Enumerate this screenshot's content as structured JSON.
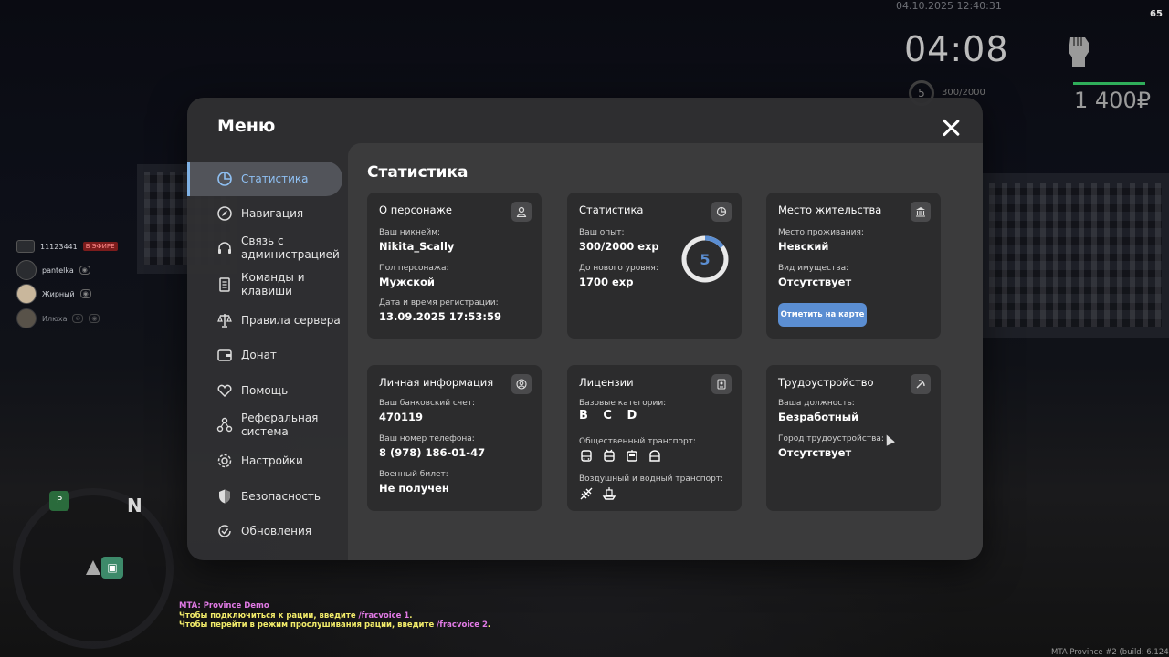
{
  "hud": {
    "datetime": "04.10.2025 12:40:31",
    "fps": "65",
    "clock": "04:08",
    "level": "5",
    "exp": "300/2000",
    "money": "1 400₽"
  },
  "voice_list": [
    {
      "name": "11123441",
      "tag": "В ЭФИРЕ"
    },
    {
      "name": "pantelka"
    },
    {
      "name": "Жирный"
    },
    {
      "name": "Илюха"
    }
  ],
  "minimap": {
    "north": "N",
    "marker": "P"
  },
  "chat": {
    "line1": "MTA: Province Demo",
    "line2_pre": "Чтобы подключиться к рации, введите ",
    "line2_cmd": "/fracvoice 1",
    "line2_post": ".",
    "line3_pre": "Чтобы перейти в режим прослушивания рации, введите ",
    "line3_cmd": "/fracvoice 2",
    "line3_post": "."
  },
  "build": "MTA Province #2 (build: 6.124",
  "menu": {
    "title": "Меню",
    "nav": [
      {
        "label": "Статистика",
        "icon": "pie-chart-icon",
        "active": true
      },
      {
        "label": "Навигация",
        "icon": "compass-icon"
      },
      {
        "label": "Связь с администрацией",
        "icon": "headset-icon"
      },
      {
        "label": "Команды и клавиши",
        "icon": "document-icon"
      },
      {
        "label": "Правила сервера",
        "icon": "scales-icon"
      },
      {
        "label": "Донат",
        "icon": "wallet-icon"
      },
      {
        "label": "Помощь",
        "icon": "heart-hands-icon"
      },
      {
        "label": "Реферальная система",
        "icon": "network-icon"
      },
      {
        "label": "Настройки",
        "icon": "gear-icon"
      },
      {
        "label": "Безопасность",
        "icon": "shield-icon"
      },
      {
        "label": "Обновления",
        "icon": "refresh-check-icon"
      }
    ],
    "content_title": "Статистика",
    "cards": {
      "character": {
        "title": "О персонаже",
        "nick_label": "Ваш никнейм:",
        "nick": "Nikita_Scally",
        "gender_label": "Пол персонажа:",
        "gender": "Мужской",
        "reg_label": "Дата и время регистрации:",
        "reg": "13.09.2025 17:53:59"
      },
      "stats": {
        "title": "Статистика",
        "exp_label": "Ваш опыт:",
        "exp": "300/2000 exp",
        "next_label": "До нового уровня:",
        "next": "1700 exp",
        "level": "5",
        "progress": 0.15
      },
      "residence": {
        "title": "Место жительства",
        "place_label": "Место проживания:",
        "place": "Невский",
        "prop_label": "Вид имущества:",
        "prop": "Отсутствует",
        "button": "Отметить на карте"
      },
      "personal": {
        "title": "Личная информация",
        "bank_label": "Ваш банковский счет:",
        "bank": "470119",
        "phone_label": "Ваш номер телефона:",
        "phone": "8 (978) 186-01-47",
        "military_label": "Военный билет:",
        "military": "Не получен"
      },
      "licenses": {
        "title": "Лицензии",
        "base_label": "Базовые категории:",
        "base": "B C D",
        "public_label": "Общественный транспорт:",
        "air_label": "Воздушный и водный транспорт:"
      },
      "job": {
        "title": "Трудоустройство",
        "pos_label": "Ваша должность:",
        "pos": "Безработный",
        "city_label": "Город трудоустройства:",
        "city": "Отсутствует"
      }
    }
  }
}
